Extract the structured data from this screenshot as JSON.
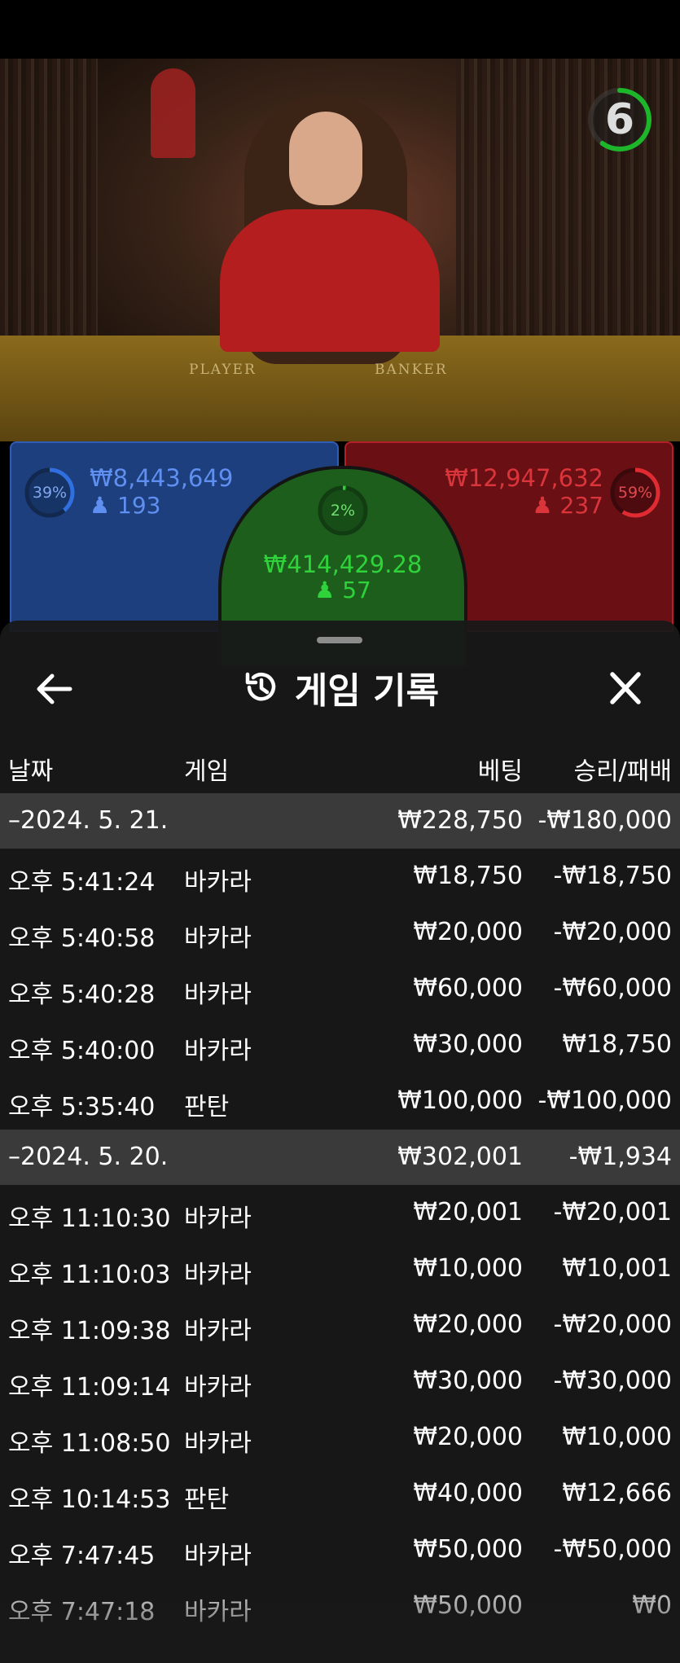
{
  "timer": {
    "value": "6",
    "fraction_remaining": 0.6
  },
  "table_labels": {
    "player": "PLAYER",
    "banker": "BANKER"
  },
  "bets": {
    "player": {
      "percent": "39%",
      "percent_value": 39,
      "amount": "₩8,443,649",
      "players": "193"
    },
    "tie": {
      "percent": "2%",
      "percent_value": 2,
      "amount": "₩414,429.28",
      "players": "57"
    },
    "banker": {
      "percent": "59%",
      "percent_value": 59,
      "amount": "₩12,947,632",
      "players": "237"
    }
  },
  "colors": {
    "player": "#2f5db5",
    "banker": "#d2242c",
    "tie": "#1fbf2a",
    "timer": "#1db52a"
  },
  "modal": {
    "title": "게임 기록",
    "back_icon": "arrow-left-icon",
    "history_icon": "history-clock-icon",
    "close_icon": "close-icon",
    "columns": {
      "date": "날짜",
      "game": "게임",
      "bet": "베팅",
      "result": "승리/패배"
    },
    "groups": [
      {
        "date": "–2024. 5. 21.",
        "bet": "₩228,750",
        "result": "-₩180,000",
        "rows": [
          {
            "time": "오후 5:41:24",
            "game": "바카라",
            "bet": "₩18,750",
            "result": "-₩18,750"
          },
          {
            "time": "오후 5:40:58",
            "game": "바카라",
            "bet": "₩20,000",
            "result": "-₩20,000"
          },
          {
            "time": "오후 5:40:28",
            "game": "바카라",
            "bet": "₩60,000",
            "result": "-₩60,000"
          },
          {
            "time": "오후 5:40:00",
            "game": "바카라",
            "bet": "₩30,000",
            "result": "₩18,750"
          },
          {
            "time": "오후 5:35:40",
            "game": "판탄",
            "bet": "₩100,000",
            "result": "-₩100,000"
          }
        ]
      },
      {
        "date": "–2024. 5. 20.",
        "bet": "₩302,001",
        "result": "-₩1,934",
        "rows": [
          {
            "time": "오후 11:10:30",
            "game": "바카라",
            "bet": "₩20,001",
            "result": "-₩20,001"
          },
          {
            "time": "오후 11:10:03",
            "game": "바카라",
            "bet": "₩10,000",
            "result": "₩10,001"
          },
          {
            "time": "오후 11:09:38",
            "game": "바카라",
            "bet": "₩20,000",
            "result": "-₩20,000"
          },
          {
            "time": "오후 11:09:14",
            "game": "바카라",
            "bet": "₩30,000",
            "result": "-₩30,000"
          },
          {
            "time": "오후 11:08:50",
            "game": "바카라",
            "bet": "₩20,000",
            "result": "₩10,000"
          },
          {
            "time": "오후 10:14:53",
            "game": "판탄",
            "bet": "₩40,000",
            "result": "₩12,666"
          },
          {
            "time": "오후 7:47:45",
            "game": "바카라",
            "bet": "₩50,000",
            "result": "-₩50,000"
          },
          {
            "time": "오후 7:47:18",
            "game": "바카라",
            "bet": "₩50,000",
            "result": "₩0"
          }
        ]
      }
    ]
  }
}
